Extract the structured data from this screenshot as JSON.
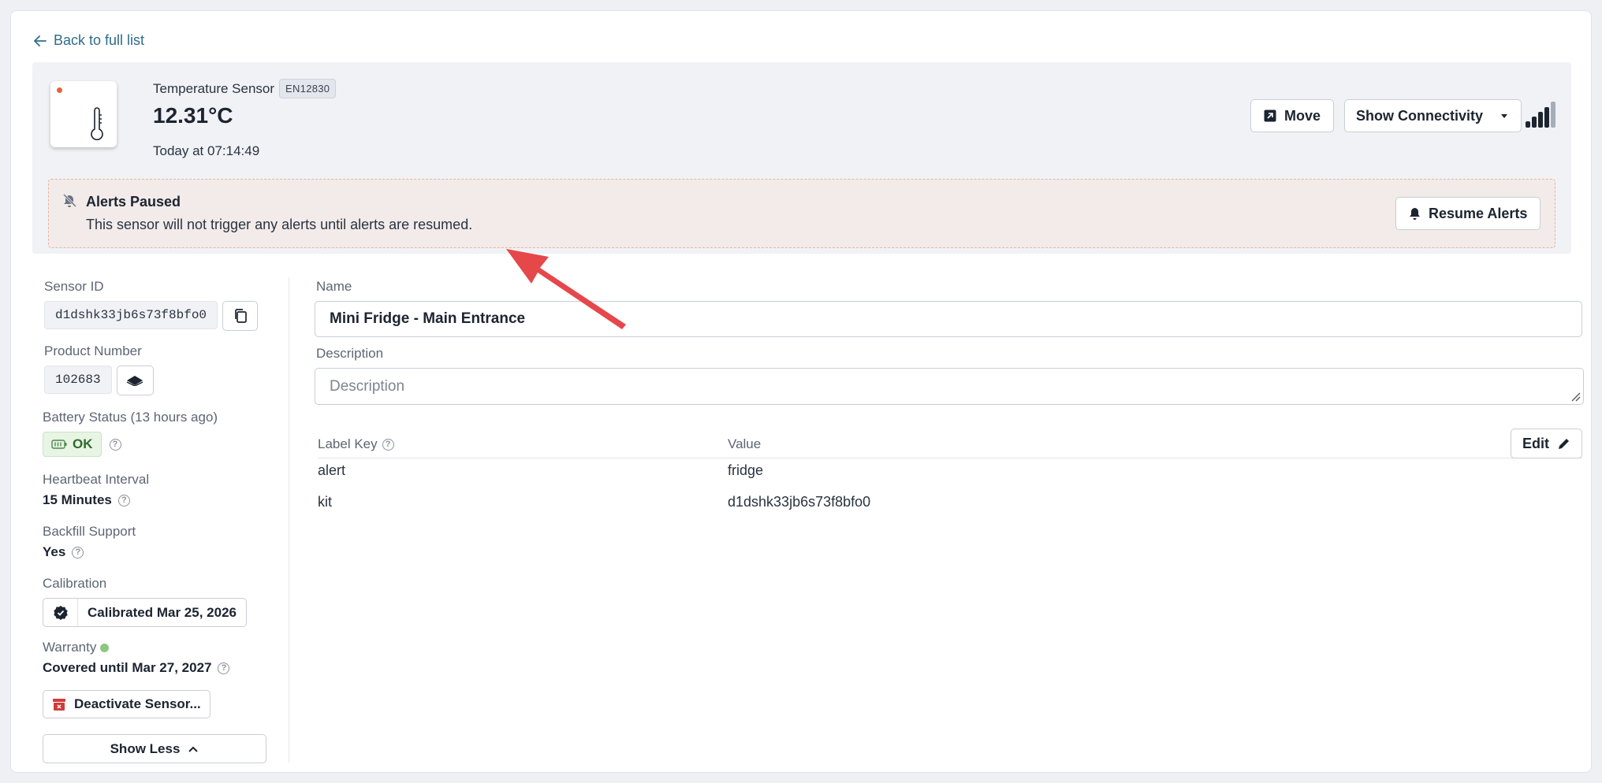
{
  "nav": {
    "back_label": "Back to full list"
  },
  "sensor": {
    "type_label": "Temperature Sensor",
    "code": "EN12830",
    "temperature": "12.31°C",
    "timestamp": "Today at 07:14:49"
  },
  "header_actions": {
    "move_label": "Move",
    "connectivity_label": "Show Connectivity"
  },
  "alert": {
    "title": "Alerts Paused",
    "message": "This sensor will not trigger any alerts until alerts are resumed.",
    "resume_label": "Resume Alerts"
  },
  "details": {
    "sensor_id_label": "Sensor ID",
    "sensor_id": "d1dshk33jb6s73f8bfo0",
    "product_number_label": "Product Number",
    "product_number": "102683",
    "battery_label": "Battery Status (13 hours ago)",
    "battery_status": "OK",
    "heartbeat_label": "Heartbeat Interval",
    "heartbeat_value": "15 Minutes",
    "backfill_label": "Backfill Support",
    "backfill_value": "Yes",
    "calibration_label": "Calibration",
    "calibration_value": "Calibrated Mar 25, 2026",
    "warranty_label": "Warranty",
    "warranty_value": "Covered until Mar 27, 2027",
    "deactivate_label": "Deactivate Sensor...",
    "show_less_label": "Show Less"
  },
  "form": {
    "name_label": "Name",
    "name_value": "Mini Fridge - Main Entrance",
    "description_label": "Description",
    "description_placeholder": "Description"
  },
  "labels": {
    "key_header": "Label Key",
    "value_header": "Value",
    "edit_label": "Edit",
    "rows": [
      {
        "key": "alert",
        "value": "fridge"
      },
      {
        "key": "kit",
        "value": "d1dshk33jb6s73f8bfo0"
      }
    ]
  },
  "colors": {
    "accent": "#2f6c8a",
    "alert_bg": "#f2ebea",
    "arrow": "#e5474b",
    "status_ok": "#2d6a2f"
  }
}
